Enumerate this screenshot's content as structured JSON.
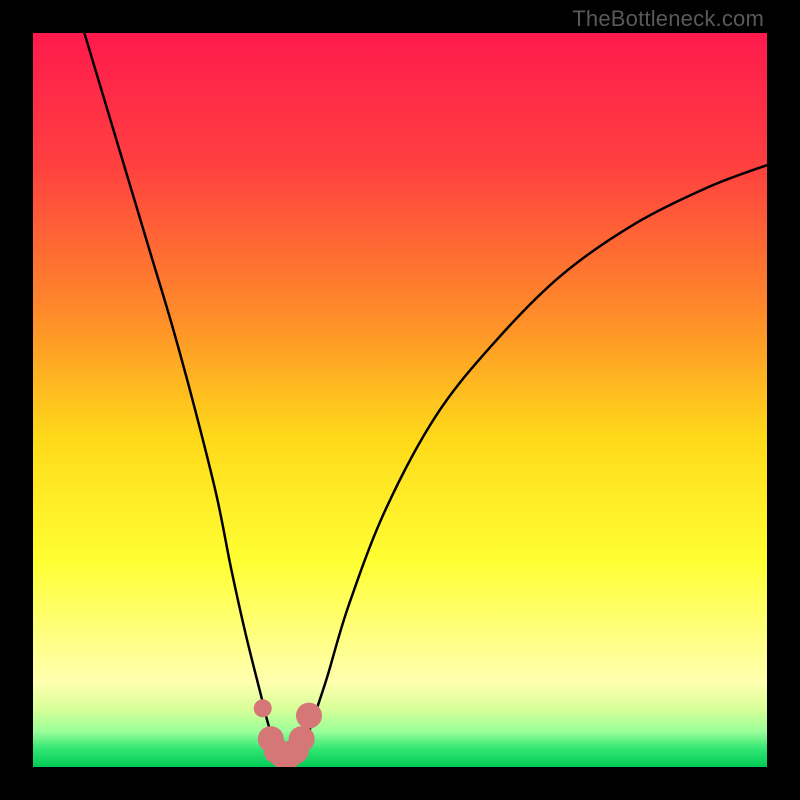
{
  "watermark": "TheBottleneck.com",
  "colors": {
    "frame": "#000000",
    "gradient_stops": [
      {
        "offset": 0.0,
        "color": "#ff1a4d"
      },
      {
        "offset": 0.18,
        "color": "#ff4040"
      },
      {
        "offset": 0.38,
        "color": "#ff8a2a"
      },
      {
        "offset": 0.55,
        "color": "#ffd91a"
      },
      {
        "offset": 0.72,
        "color": "#ffff33"
      },
      {
        "offset": 0.82,
        "color": "#ffff80"
      },
      {
        "offset": 0.885,
        "color": "#ffffb0"
      },
      {
        "offset": 0.92,
        "color": "#d9ff99"
      },
      {
        "offset": 0.952,
        "color": "#99ff99"
      },
      {
        "offset": 0.975,
        "color": "#33e673"
      },
      {
        "offset": 1.0,
        "color": "#00cc55"
      }
    ],
    "curve": "#000000",
    "marker": "#d67777"
  },
  "chart_data": {
    "type": "line",
    "title": "",
    "xlabel": "",
    "ylabel": "",
    "xlim": [
      0,
      100
    ],
    "ylim": [
      0,
      100
    ],
    "series": [
      {
        "name": "bottleneck-curve",
        "x": [
          7,
          10,
          13,
          16,
          19,
          22,
          25,
          27,
          29,
          31,
          32,
          33,
          34,
          35,
          36,
          37,
          38,
          40,
          43,
          48,
          55,
          63,
          72,
          82,
          92,
          100
        ],
        "y": [
          100,
          90,
          80,
          70,
          60,
          49,
          37,
          27,
          18,
          10,
          6,
          3,
          1.5,
          1,
          1.5,
          3,
          6,
          12,
          22,
          35,
          48,
          58,
          67,
          74,
          79,
          82
        ]
      }
    ],
    "markers": {
      "name": "highlight-points",
      "x": [
        31.3,
        32.4,
        33.2,
        34.0,
        34.9,
        35.8,
        36.6,
        37.6
      ],
      "y": [
        8.0,
        3.8,
        2.2,
        1.6,
        1.6,
        2.2,
        3.8,
        7.0
      ],
      "size_first": 9,
      "size_rest": 13
    }
  }
}
